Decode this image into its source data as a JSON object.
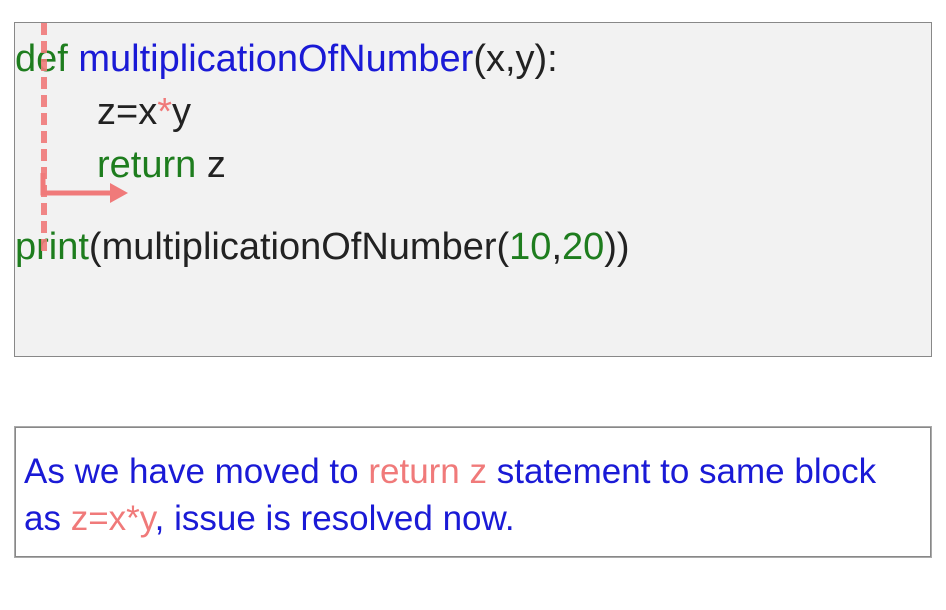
{
  "code": {
    "def": "def",
    "funcname": "multiplicationOfNumber",
    "params": "(x,y):",
    "line2_var": "z=x",
    "line2_op": "*",
    "line2_rest": "y",
    "ret_kw": "return",
    "ret_var": " z",
    "print_kw": "print",
    "call_open": "(",
    "call_name": "multiplicationOfNumber",
    "call_paren_open": "(",
    "arg1": "10",
    "comma": ",",
    "arg2": "20",
    "call_close": "))"
  },
  "note": {
    "part1": "As we have moved to ",
    "ret": "return z",
    "part2": " statement to same block as ",
    "expr": "z=x*y",
    "part3": ", issue is resolved now."
  }
}
